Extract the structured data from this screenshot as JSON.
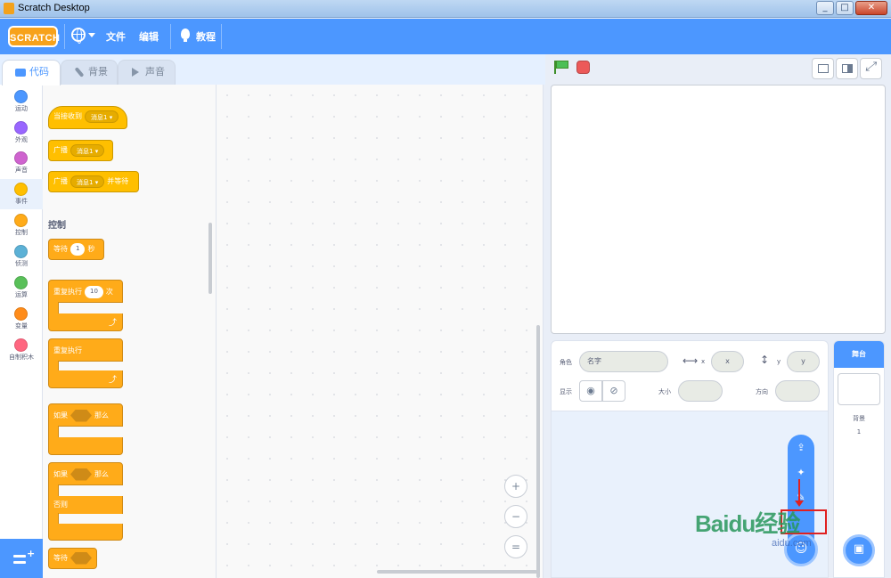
{
  "window": {
    "title": "Scratch Desktop",
    "controls": [
      "_",
      "□",
      "✕"
    ]
  },
  "menubar": {
    "logo": "SCRATCH",
    "file": "文件",
    "edit": "编辑",
    "tutorials": "教程"
  },
  "tabs": {
    "code": "代码",
    "costumes": "背景",
    "sounds": "声音"
  },
  "categories": [
    {
      "label": "运动",
      "color": "#4c97ff"
    },
    {
      "label": "外观",
      "color": "#9966ff"
    },
    {
      "label": "声音",
      "color": "#cf63cf"
    },
    {
      "label": "事件",
      "color": "#ffbf00"
    },
    {
      "label": "控制",
      "color": "#ffab19"
    },
    {
      "label": "侦测",
      "color": "#5cb1d6"
    },
    {
      "label": "运算",
      "color": "#59c059"
    },
    {
      "label": "变量",
      "color": "#ff8c1a"
    },
    {
      "label": "自制积木",
      "color": "#ff6680"
    }
  ],
  "palette": {
    "events": {
      "when_receive": "当接收到",
      "broadcast": "广播",
      "broadcast_wait_prefix": "广播",
      "broadcast_wait_suffix": "并等待",
      "message": "消息1"
    },
    "control_title": "控制",
    "control": {
      "wait": "等待",
      "wait_value": "1",
      "wait_unit": "秒",
      "repeat": "重复执行",
      "repeat_value": "10",
      "repeat_unit": "次",
      "forever": "重复执行",
      "if": "如果",
      "then": "那么",
      "if2": "如果",
      "then2": "那么",
      "else": "否则",
      "wait_until": "等待"
    }
  },
  "zoom": {
    "in": "+",
    "out": "−",
    "reset": "="
  },
  "sprite_info": {
    "sprite_label": "角色",
    "name_placeholder": "名字",
    "x_label": "x",
    "x_placeholder": "x",
    "y_label": "y",
    "y_placeholder": "y",
    "show_label": "显示",
    "size_label": "大小",
    "direction_label": "方向"
  },
  "stage_panel": {
    "title": "舞台",
    "backdrops_label": "背景",
    "backdrops_count": "1"
  },
  "watermark": {
    "brand": "Baidu经验",
    "sub": "aidu.com"
  }
}
